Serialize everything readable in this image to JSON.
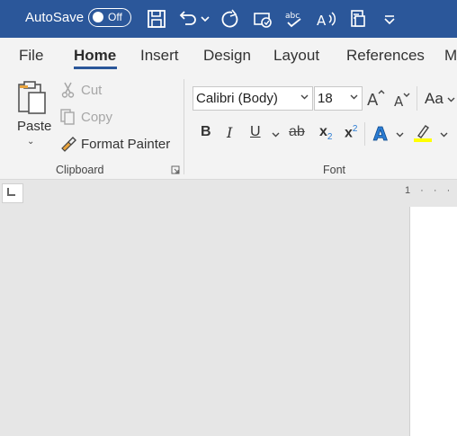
{
  "title_bar": {
    "autosave_label": "AutoSave",
    "autosave_state": "Off",
    "background_color": "#2b579a",
    "quick_access_icons": [
      "save-icon",
      "undo-icon",
      "redo-icon",
      "touch-mode-icon",
      "spelling-icon",
      "read-aloud-icon",
      "dictate-icon",
      "customize-qat-icon"
    ]
  },
  "tabs": [
    "File",
    "Home",
    "Insert",
    "Design",
    "Layout",
    "References",
    "M"
  ],
  "active_tab": "Home",
  "clipboard": {
    "paste_label": "Paste",
    "cut_label": "Cut",
    "copy_label": "Copy",
    "format_painter_label": "Format Painter",
    "group_label": "Clipboard"
  },
  "font": {
    "font_name": "Calibri (Body)",
    "font_size": "18",
    "group_label": "Font",
    "bold": "B",
    "italic": "I",
    "underline": "U",
    "strikethrough": "ab",
    "subscript": "x",
    "superscript": "x",
    "change_case": "Aa",
    "highlight_color": "#ffff00",
    "text_effects_color": "#2b7cd3"
  },
  "ruler": {
    "marker": "1 · · ·"
  }
}
